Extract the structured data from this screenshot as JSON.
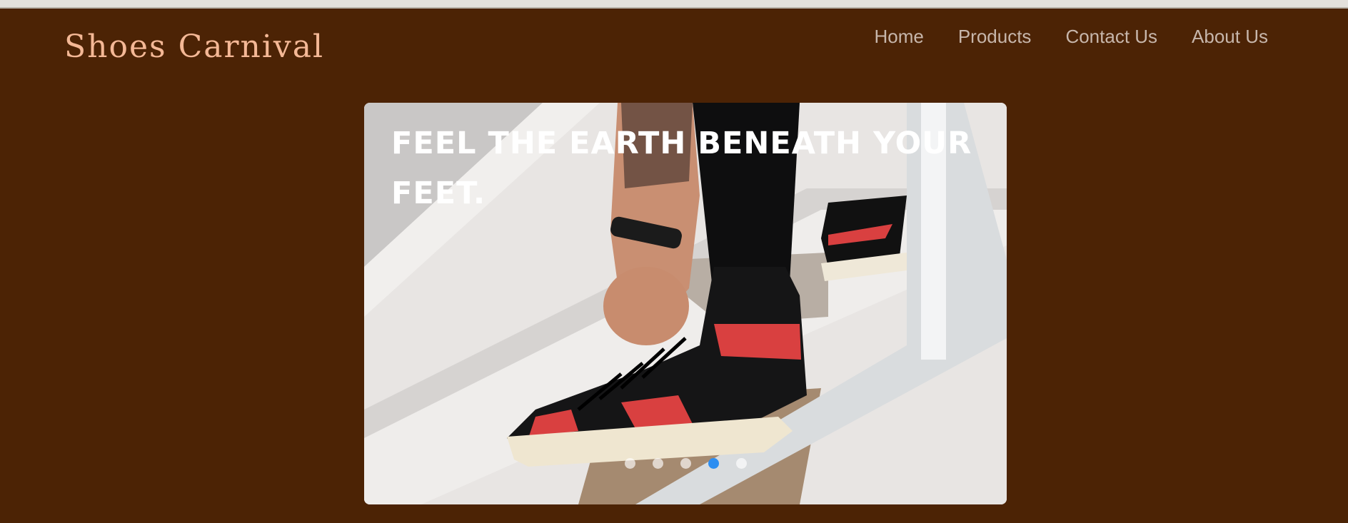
{
  "header": {
    "brand": "Shoes Carnival",
    "nav": [
      "Home",
      "Products",
      "Contact Us",
      "About Us"
    ]
  },
  "hero": {
    "headline": "Feel the earth beneath your feet.",
    "slide_count": 5,
    "active_slide": 4
  },
  "colors": {
    "background": "#4c2305",
    "brand": "#f4b896",
    "nav_text": "#c7b6ab",
    "active_dot": "#2c8ef1"
  }
}
